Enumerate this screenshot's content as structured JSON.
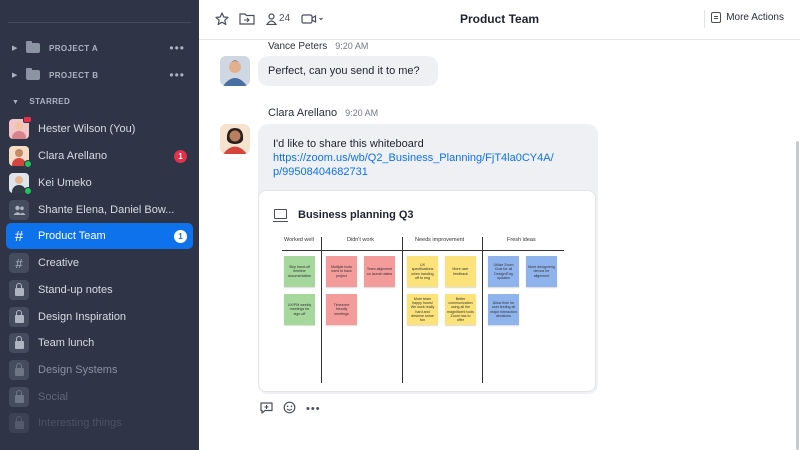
{
  "sidebar": {
    "projects": [
      {
        "label": "PROJECT A"
      },
      {
        "label": "PROJECT B"
      }
    ],
    "starred_label": "STARRED",
    "items": [
      {
        "label": "Hester Wilson (You)"
      },
      {
        "label": "Clara Arellano",
        "badge": "1"
      },
      {
        "label": "Kei Umeko"
      },
      {
        "label": "Shante Elena, Daniel Bow..."
      },
      {
        "label": "Product Team",
        "badge": "1"
      },
      {
        "label": "Creative"
      },
      {
        "label": "Stand-up notes"
      },
      {
        "label": "Design Inspiration"
      },
      {
        "label": "Team lunch"
      },
      {
        "label": "Design Systems"
      },
      {
        "label": "Social"
      },
      {
        "label": "Interesting things"
      }
    ]
  },
  "header": {
    "title": "Product Team",
    "member_count": "24",
    "more_actions": "More Actions"
  },
  "messages": [
    {
      "sender": "Vance Peters",
      "time": "9:20 AM",
      "text": "Perfect, can you send it to me?"
    },
    {
      "sender": "Clara Arellano",
      "time": "9:20 AM",
      "text": "I'd like to share this whiteboard",
      "link_line1": "https://zoom.us/wb/Q2_Business_Planning/FjT4la0CY4A/",
      "link_line2": "p/99508404682731"
    }
  ],
  "whiteboard": {
    "title": "Business planning Q3",
    "columns": [
      "Worked well",
      "Didn't work",
      "Needs improvement",
      "Fresh ideas"
    ],
    "stickies": {
      "worked_1": "Skip hand-off timeline documentation",
      "worked_2": "UX/PM weekly meetings for sign-off",
      "didnt_1": "Multiple tools used to track project",
      "didnt_2": "Team alignment on launch dates",
      "didnt_3": "Timezone friendly meetings",
      "needs_1": "UX specifications when handing off to eng",
      "needs_2": "More user feedback",
      "needs_3": "More team happy hours! We work really hard and deserve some fun",
      "needs_4": "Better communication using all the magnificent tools Zoom has to offer",
      "fresh_1": "Utilize Zoom Chat for all Design/Eng updates",
      "fresh_2": "More design/eng demos for alignment",
      "fresh_3": "Allow time for user testing all major interaction decisions"
    }
  },
  "colors": {
    "sidebar_bg": "#2f3546",
    "accent": "#0e72ed",
    "badge_red": "#e0324b",
    "presence_green": "#21c35b"
  }
}
